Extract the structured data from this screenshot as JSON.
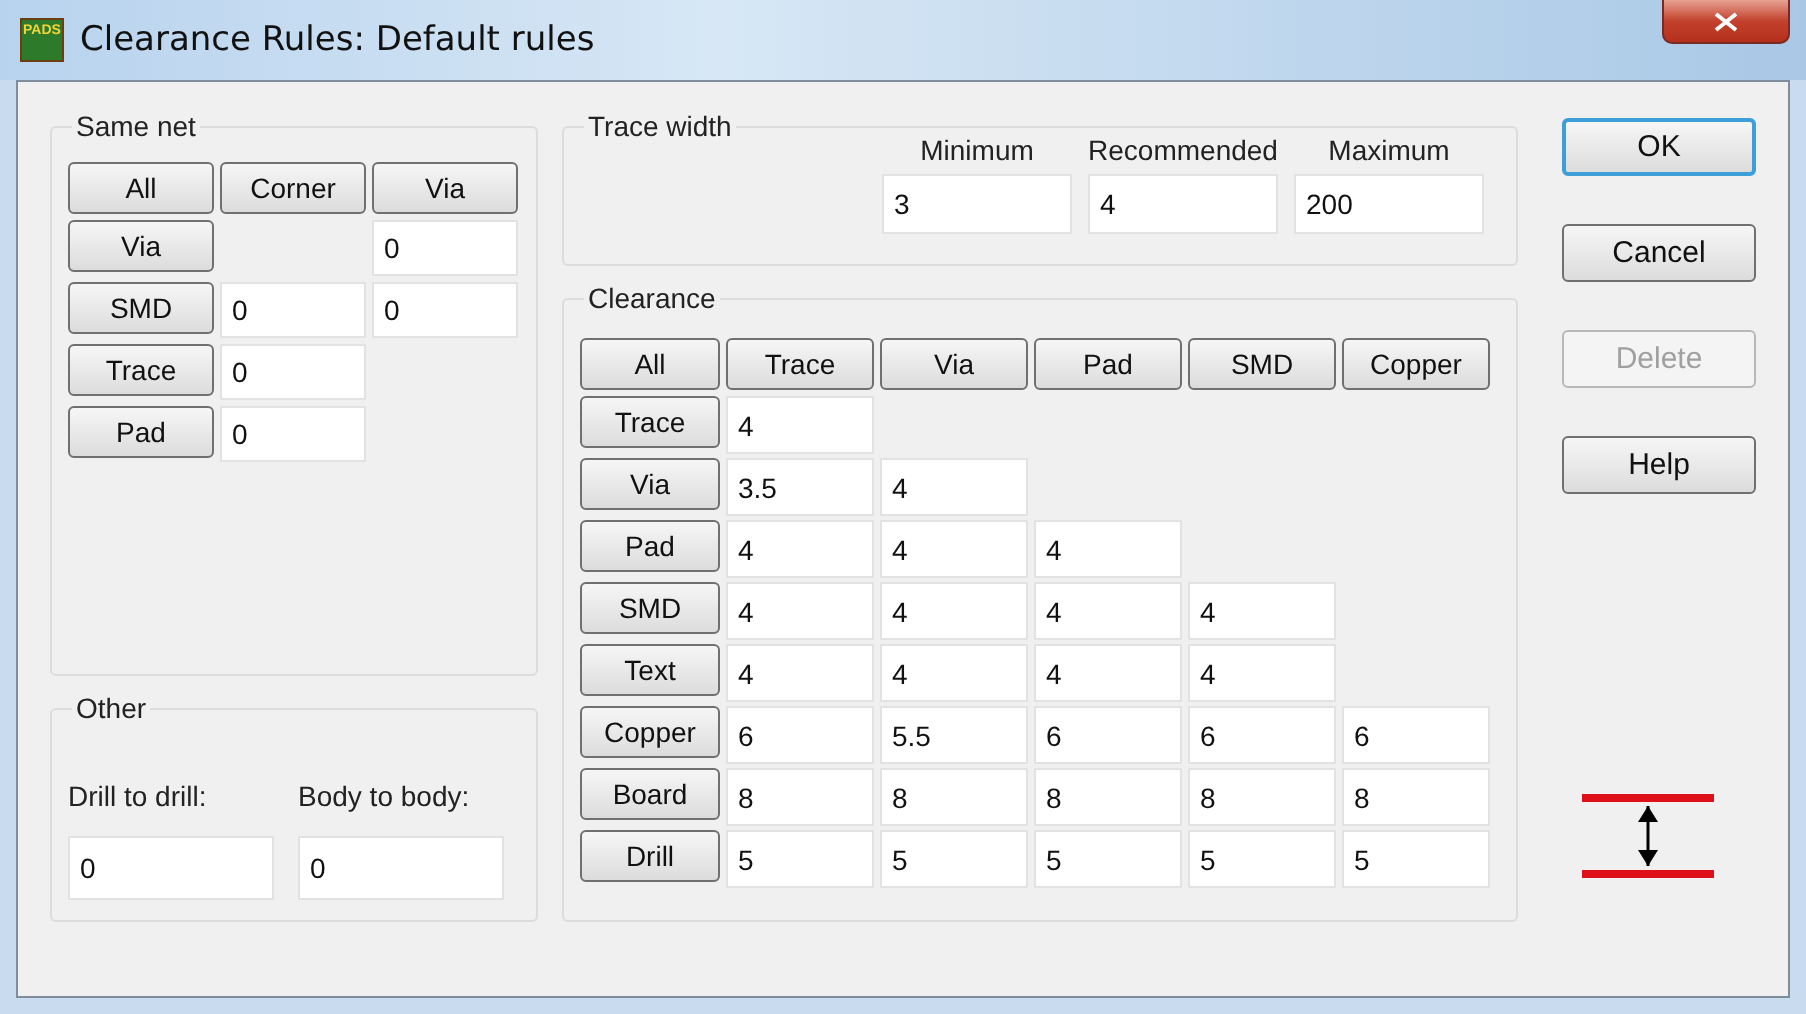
{
  "window": {
    "title": "Clearance Rules: Default rules",
    "icon_text": "PADS"
  },
  "same_net": {
    "title": "Same net",
    "columns": [
      "All",
      "Corner",
      "Via"
    ],
    "rows": [
      {
        "label": "Via",
        "cells": [
          {
            "kind": "none"
          },
          {
            "kind": "field",
            "value": "0"
          }
        ]
      },
      {
        "label": "SMD",
        "cells": [
          {
            "kind": "field",
            "value": "0"
          },
          {
            "kind": "field",
            "value": "0"
          }
        ]
      },
      {
        "label": "Trace",
        "cells": [
          {
            "kind": "field",
            "value": "0"
          }
        ]
      },
      {
        "label": "Pad",
        "cells": [
          {
            "kind": "field",
            "value": "0"
          }
        ]
      }
    ]
  },
  "other": {
    "title": "Other",
    "fields": [
      {
        "label": "Drill to drill:",
        "value": "0"
      },
      {
        "label": "Body to body:",
        "value": "0"
      }
    ]
  },
  "trace_width": {
    "title": "Trace width",
    "fields": [
      {
        "label": "Minimum",
        "value": "3"
      },
      {
        "label": "Recommended",
        "value": "4"
      },
      {
        "label": "Maximum",
        "value": "200"
      }
    ]
  },
  "clearance": {
    "title": "Clearance",
    "columns": [
      "All",
      "Trace",
      "Via",
      "Pad",
      "SMD",
      "Copper"
    ],
    "rows": [
      {
        "label": "Trace",
        "values": [
          "4"
        ]
      },
      {
        "label": "Via",
        "values": [
          "3.5",
          "4"
        ]
      },
      {
        "label": "Pad",
        "values": [
          "4",
          "4",
          "4"
        ]
      },
      {
        "label": "SMD",
        "values": [
          "4",
          "4",
          "4",
          "4"
        ]
      },
      {
        "label": "Text",
        "values": [
          "4",
          "4",
          "4",
          "4"
        ]
      },
      {
        "label": "Copper",
        "values": [
          "6",
          "5.5",
          "6",
          "6",
          "6"
        ]
      },
      {
        "label": "Board",
        "values": [
          "8",
          "8",
          "8",
          "8",
          "8"
        ]
      },
      {
        "label": "Drill",
        "values": [
          "5",
          "5",
          "5",
          "5",
          "5"
        ]
      }
    ]
  },
  "buttons": [
    {
      "label": "OK",
      "default": true,
      "disabled": false
    },
    {
      "label": "Cancel",
      "default": false,
      "disabled": false
    },
    {
      "label": "Delete",
      "default": false,
      "disabled": true
    },
    {
      "label": "Help",
      "default": false,
      "disabled": false
    }
  ]
}
